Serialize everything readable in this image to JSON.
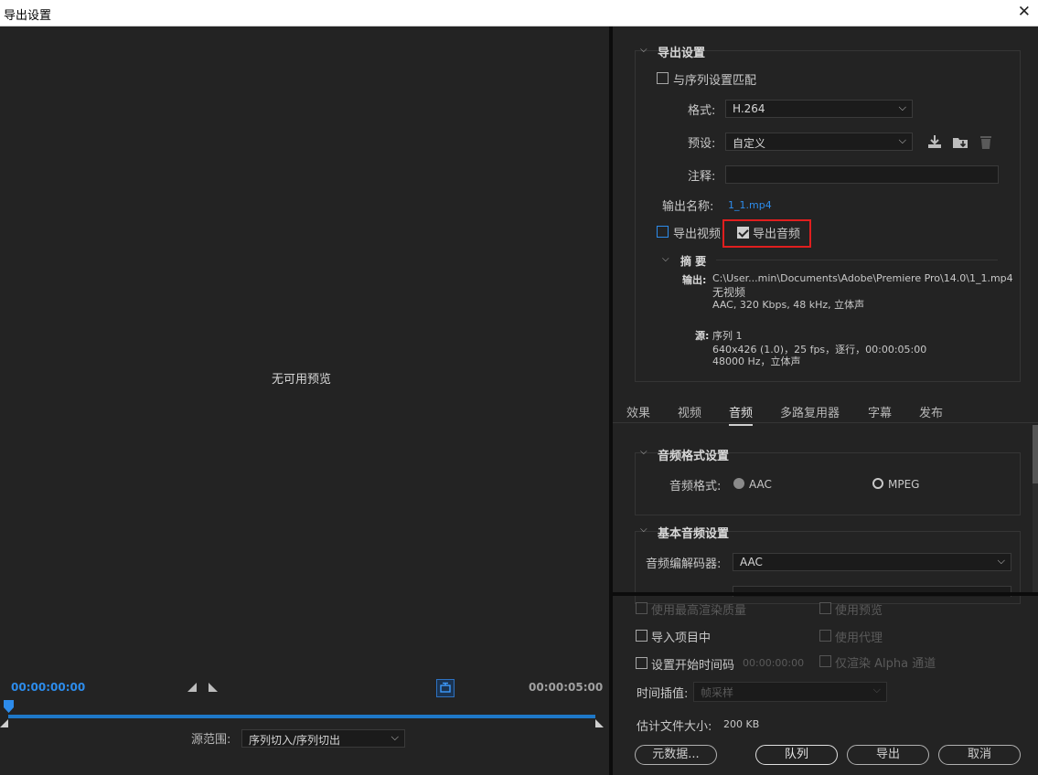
{
  "window": {
    "title": "导出设置",
    "close_icon": "close-icon"
  },
  "preview": {
    "no_preview_text": "无可用预览",
    "timecode_start": "00:00:00:00",
    "timecode_end": "00:00:05:00",
    "source_range_label": "源范围:",
    "source_range_value": "序列切入/序列切出"
  },
  "export_settings": {
    "section_title": "导出设置",
    "match_sequence_label": "与序列设置匹配",
    "format_label": "格式:",
    "format_value": "H.264",
    "preset_label": "预设:",
    "preset_value": "自定义",
    "comment_label": "注释:",
    "comment_value": "",
    "output_name_label": "输出名称:",
    "output_name_value": "1_1.mp4",
    "export_video_label": "导出视频",
    "export_video_checked": false,
    "export_audio_label": "导出音频",
    "export_audio_checked": true,
    "summary": {
      "title": "摘 要",
      "output_label": "输出:",
      "output_path": "C:\\User...min\\Documents\\Adobe\\Premiere Pro\\14.0\\1_1.mp4",
      "output_video": "无视频",
      "output_audio": "AAC, 320 Kbps, 48  kHz, 立体声",
      "source_label": "源:",
      "source_name": "序列 1",
      "source_video": "640x426 (1.0)，25 fps，逐行，00:00:05:00",
      "source_audio": "48000 Hz，立体声"
    }
  },
  "tabs": [
    {
      "label": "效果"
    },
    {
      "label": "视频"
    },
    {
      "label": "音频",
      "active": true
    },
    {
      "label": "多路复用器"
    },
    {
      "label": "字幕"
    },
    {
      "label": "发布"
    }
  ],
  "audio": {
    "format_section_title": "音频格式设置",
    "format_label": "音频格式:",
    "format_options": [
      "AAC",
      "MPEG"
    ],
    "format_selected": "AAC",
    "basic_section_title": "基本音频设置",
    "codec_label": "音频编解码器:",
    "codec_value": "AAC"
  },
  "bottom": {
    "max_render_quality": "使用最高渲染质量",
    "use_previews": "使用预览",
    "import_into_project": "导入项目中",
    "use_proxies": "使用代理",
    "set_start_timecode": "设置开始时间码",
    "start_timecode_value": "00:00:00:00",
    "render_alpha": "仅渲染 Alpha 通道",
    "time_interp_label": "时间插值:",
    "time_interp_value": "帧采样",
    "est_size_label": "估计文件大小:",
    "est_size_value": "200 KB"
  },
  "buttons": {
    "metadata": "元数据...",
    "queue": "队列",
    "export": "导出",
    "cancel": "取消"
  },
  "colors": {
    "accent": "#2d8ceb",
    "highlight_box": "#e01e1e",
    "background": "#232323"
  }
}
